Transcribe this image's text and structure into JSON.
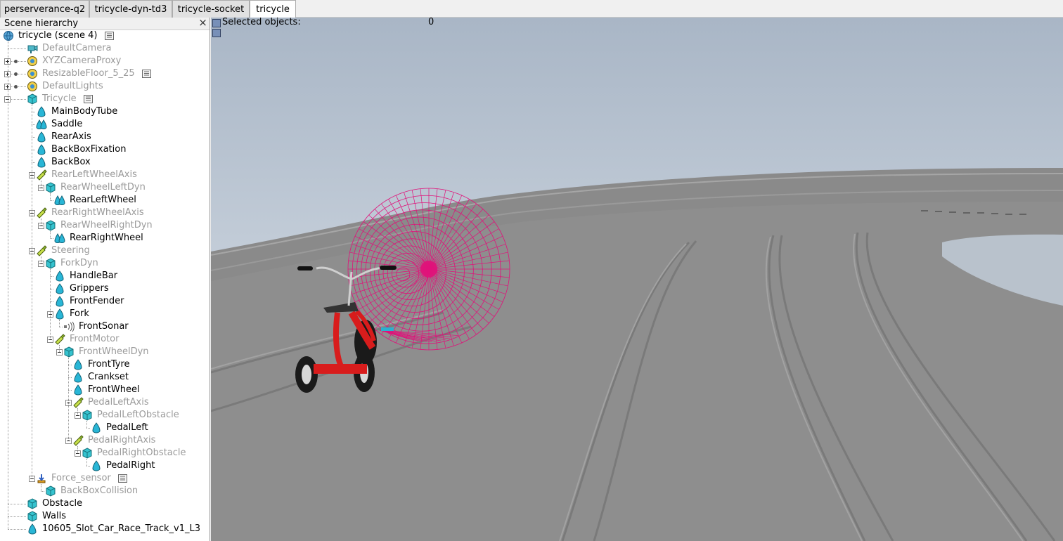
{
  "tabs": [
    {
      "label": "perserverance-q2",
      "active": false
    },
    {
      "label": "tricycle-dyn-td3",
      "active": false
    },
    {
      "label": "tricycle-socket",
      "active": false
    },
    {
      "label": "tricycle",
      "active": true
    }
  ],
  "hierarchy": {
    "title": "Scene hierarchy",
    "close_glyph": "×",
    "items": [
      {
        "label": "tricycle (scene 4)",
        "icon": "globe-icon",
        "active": true
      },
      {
        "label": "DefaultCamera",
        "icon": "camera-icon",
        "active": false
      },
      {
        "label": "XYZCameraProxy",
        "icon": "dummy-icon",
        "active": false
      },
      {
        "label": "ResizableFloor_5_25",
        "icon": "dummy-icon",
        "active": false
      },
      {
        "label": "DefaultLights",
        "icon": "dummy-icon",
        "active": false
      },
      {
        "label": "Tricycle",
        "icon": "cube-icon",
        "active": false
      },
      {
        "label": "MainBodyTube",
        "icon": "shape-icon",
        "active": true
      },
      {
        "label": "Saddle",
        "icon": "compound-shape-icon",
        "active": true
      },
      {
        "label": "RearAxis",
        "icon": "shape-icon",
        "active": true
      },
      {
        "label": "BackBoxFixation",
        "icon": "shape-icon",
        "active": true
      },
      {
        "label": "BackBox",
        "icon": "shape-icon",
        "active": true
      },
      {
        "label": "RearLeftWheelAxis",
        "icon": "joint-icon",
        "active": false
      },
      {
        "label": "RearWheelLeftDyn",
        "icon": "cube-icon",
        "active": false
      },
      {
        "label": "RearLeftWheel",
        "icon": "compound-shape-icon",
        "active": true
      },
      {
        "label": "RearRightWheelAxis",
        "icon": "joint-icon",
        "active": false
      },
      {
        "label": "RearWheelRightDyn",
        "icon": "cube-icon",
        "active": false
      },
      {
        "label": "RearRightWheel",
        "icon": "compound-shape-icon",
        "active": true
      },
      {
        "label": "Steering",
        "icon": "joint-icon",
        "active": false
      },
      {
        "label": "ForkDyn",
        "icon": "cube-icon",
        "active": false
      },
      {
        "label": "HandleBar",
        "icon": "shape-icon",
        "active": true
      },
      {
        "label": "Grippers",
        "icon": "shape-icon",
        "active": true
      },
      {
        "label": "FrontFender",
        "icon": "shape-icon",
        "active": true
      },
      {
        "label": "Fork",
        "icon": "shape-icon",
        "active": true
      },
      {
        "label": "FrontSonar",
        "icon": "sonar-icon",
        "active": true
      },
      {
        "label": "FrontMotor",
        "icon": "joint-icon",
        "active": false
      },
      {
        "label": "FrontWheelDyn",
        "icon": "cube-icon",
        "active": false
      },
      {
        "label": "FrontTyre",
        "icon": "shape-icon",
        "active": true
      },
      {
        "label": "Crankset",
        "icon": "shape-icon",
        "active": true
      },
      {
        "label": "FrontWheel",
        "icon": "shape-icon",
        "active": true
      },
      {
        "label": "PedalLeftAxis",
        "icon": "joint-icon",
        "active": false
      },
      {
        "label": "PedalLeftObstacle",
        "icon": "cube-icon",
        "active": false
      },
      {
        "label": "PedalLeft",
        "icon": "shape-icon",
        "active": true
      },
      {
        "label": "PedalRightAxis",
        "icon": "joint-icon",
        "active": false
      },
      {
        "label": "PedalRightObstacle",
        "icon": "cube-icon",
        "active": false
      },
      {
        "label": "PedalRight",
        "icon": "shape-icon",
        "active": true
      },
      {
        "label": "Force_sensor",
        "icon": "force-sensor-icon",
        "active": false
      },
      {
        "label": "BackBoxCollision",
        "icon": "cube-icon",
        "active": false
      },
      {
        "label": "Obstacle",
        "icon": "cube-icon",
        "active": true
      },
      {
        "label": "Walls",
        "icon": "cube-icon",
        "active": true
      },
      {
        "label": "10605_Slot_Car_Race_Track_v1_L3",
        "icon": "shape-icon",
        "active": true
      }
    ]
  },
  "viewport": {
    "selected_label": "Selected objects:",
    "selected_count": "0"
  },
  "colors": {
    "sky_top": "#a9b6c6",
    "sky_bottom": "#e2e8ee",
    "track": "#8e8e8e",
    "sonar_cone": "#e0127a",
    "tricycle_frame": "#d81c1c",
    "shape_icon": "#29b6d6",
    "cube_icon": "#36c3cf"
  }
}
